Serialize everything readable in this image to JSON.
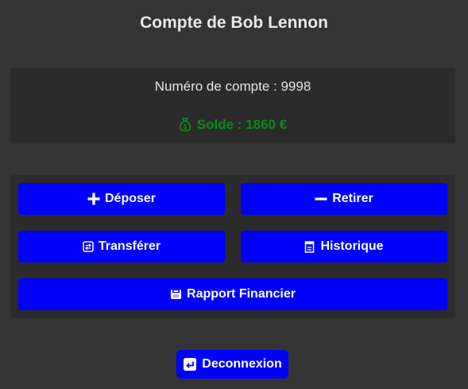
{
  "header": {
    "title": "Compte de Bob Lennon"
  },
  "account": {
    "number_label": "Numéro de compte : 9998",
    "balance_label": "Solde : 1860 €",
    "balance_icon": "money-bag-icon",
    "balance_color": "#0b8a18"
  },
  "actions": {
    "deposit": {
      "label": "Déposer",
      "icon": "plus-icon"
    },
    "withdraw": {
      "label": "Retirer",
      "icon": "minus-icon"
    },
    "transfer": {
      "label": "Transférer",
      "icon": "transfer-icon"
    },
    "history": {
      "label": "Historique",
      "icon": "history-icon"
    },
    "report": {
      "label": "Rapport Financier",
      "icon": "report-icon"
    }
  },
  "footer": {
    "logout": {
      "label": "Deconnexion",
      "icon": "logout-icon"
    }
  },
  "colors": {
    "background": "#343434",
    "card": "#2b2b2b",
    "button": "#0000ff",
    "text": "#e8e8e8"
  }
}
